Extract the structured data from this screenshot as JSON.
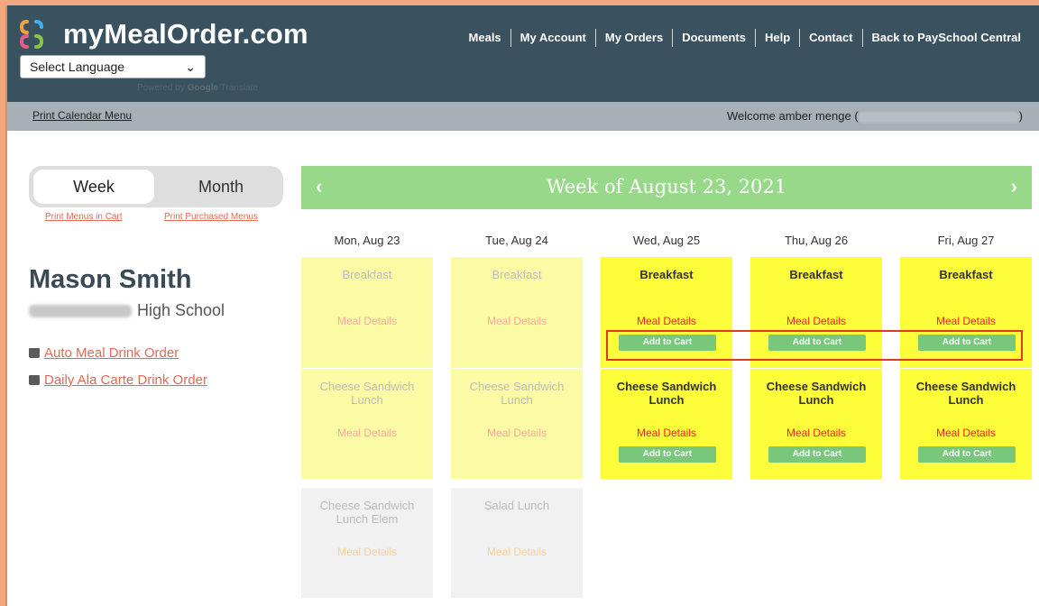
{
  "brand": {
    "name": "myMealOrder.com"
  },
  "language": {
    "selected": "Select Language",
    "powered_prefix": "Powered by",
    "powered_google": "Google",
    "powered_suffix": "Translate"
  },
  "nav": [
    {
      "label": "Meals"
    },
    {
      "label": "My Account"
    },
    {
      "label": "My Orders"
    },
    {
      "label": "Documents"
    },
    {
      "label": "Help"
    },
    {
      "label": "Contact"
    },
    {
      "label": "Back to PaySchool Central"
    }
  ],
  "subbar": {
    "print_calendar": "Print Calendar Menu",
    "welcome_prefix": "Welcome amber menge (",
    "welcome_suffix": ")"
  },
  "view_toggle": {
    "week": "Week",
    "month": "Month"
  },
  "print_links": {
    "cart": "Print Menus in Cart",
    "purchased": "Print Purchased Menus"
  },
  "student": {
    "name": "Mason Smith",
    "school_suffix": "High School"
  },
  "drink_links": [
    {
      "label": "Auto Meal Drink Order"
    },
    {
      "label": "Daily Ala Carte Drink Order"
    }
  ],
  "week": {
    "title": "Week of August 23, 2021",
    "prev_icon": "‹",
    "next_icon": "›"
  },
  "days": [
    {
      "label": "Mon, Aug 23"
    },
    {
      "label": "Tue, Aug 24"
    },
    {
      "label": "Wed, Aug 25"
    },
    {
      "label": "Thu, Aug 26"
    },
    {
      "label": "Fri, Aug 27"
    }
  ],
  "meals": {
    "breakfast": "Breakfast",
    "cheese_lunch": "Cheese Sandwich Lunch",
    "cheese_lunch_elem": "Cheese Sandwich Lunch Elem",
    "salad_lunch": "Salad Lunch",
    "details": "Meal Details",
    "add_to_cart": "Add to Cart"
  }
}
